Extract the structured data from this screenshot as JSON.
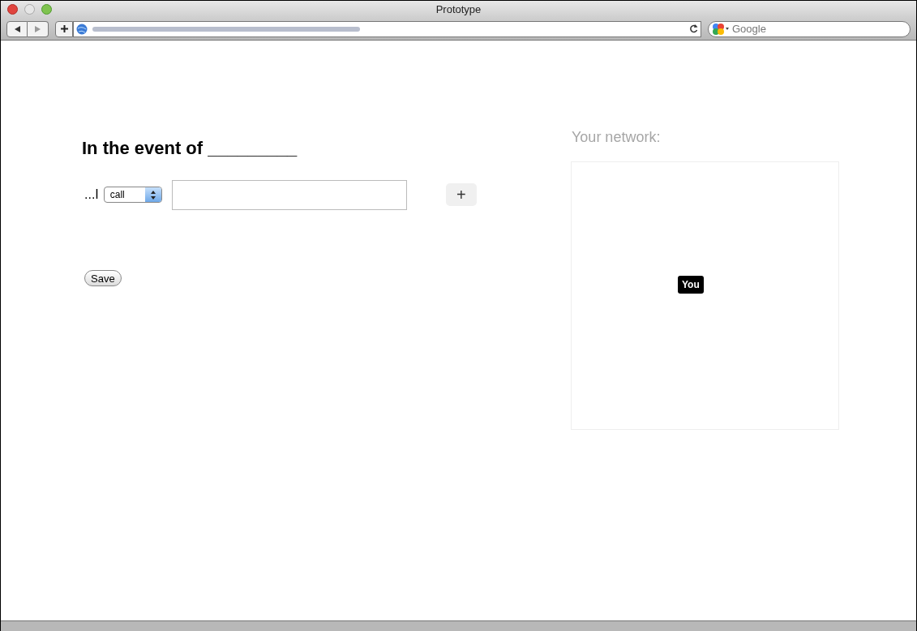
{
  "window": {
    "title": "Prototype"
  },
  "toolbar": {
    "search": {
      "placeholder": "Google"
    }
  },
  "form": {
    "heading": "In the event of _________",
    "prefix": "...I",
    "action": {
      "value": "call"
    },
    "add_label": "+",
    "save_label": "Save"
  },
  "network": {
    "title": "Your network:",
    "nodes": [
      {
        "label": "You"
      }
    ]
  }
}
